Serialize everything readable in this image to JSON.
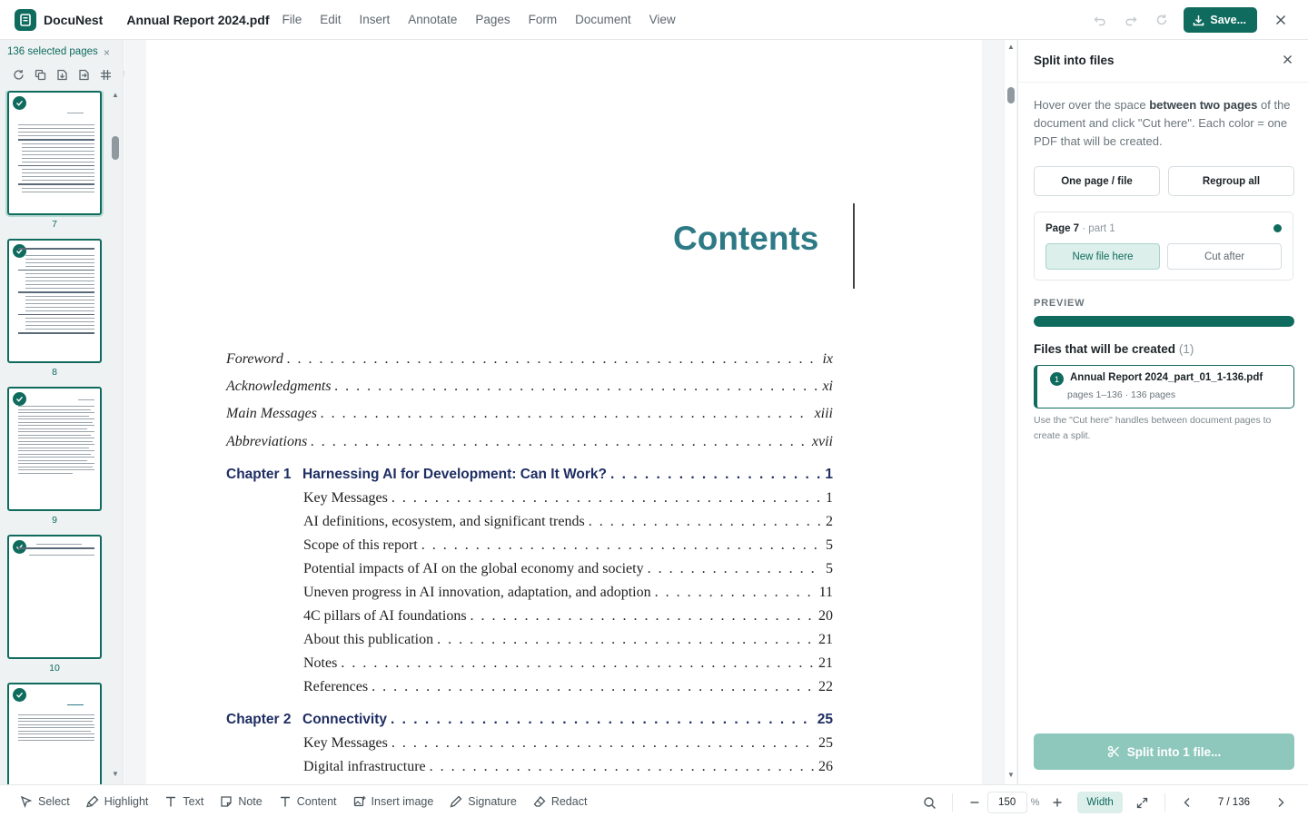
{
  "app": {
    "name": "DocuNest",
    "doc_title": "Annual Report 2024.pdf",
    "save_label": "Save...",
    "menu": [
      "File",
      "Edit",
      "Insert",
      "Annotate",
      "Pages",
      "Form",
      "Document",
      "View"
    ],
    "accent_color": "#0f6b5e"
  },
  "sidebar": {
    "selected_label": "136 selected pages",
    "close_label": "×",
    "thumbnails": [
      {
        "page": "7",
        "kind": "contents"
      },
      {
        "page": "8",
        "kind": "toc"
      },
      {
        "page": "9",
        "kind": "dense"
      },
      {
        "page": "10",
        "kind": "sparse"
      },
      {
        "page": "",
        "kind": "foreword"
      }
    ]
  },
  "document": {
    "contents_title": "Contents",
    "front_matter": [
      {
        "title": "Foreword",
        "page": "ix"
      },
      {
        "title": "Acknowledgments",
        "page": "xi"
      },
      {
        "title": "Main Messages",
        "page": "xiii"
      },
      {
        "title": "Abbreviations",
        "page": "xvii"
      }
    ],
    "chapters": [
      {
        "label": "Chapter 1",
        "title": "Harnessing AI for Development: Can It Work?",
        "page": "1",
        "sections": [
          {
            "title": "Key Messages",
            "page": "1"
          },
          {
            "title": "AI definitions, ecosystem, and significant trends",
            "page": "2"
          },
          {
            "title": "Scope of this report",
            "page": "5"
          },
          {
            "title": "Potential impacts of AI on the global economy and society",
            "page": "5"
          },
          {
            "title": "Uneven progress in AI innovation, adaptation, and adoption",
            "page": "11"
          },
          {
            "title": "4C pillars of AI foundations",
            "page": "20"
          },
          {
            "title": "About this publication",
            "page": "21"
          },
          {
            "title": "Notes",
            "page": "21"
          },
          {
            "title": "References",
            "page": "22"
          }
        ]
      },
      {
        "label": "Chapter 2",
        "title": "Connectivity",
        "page": "25",
        "sections": [
          {
            "title": "Key Messages",
            "page": "25"
          },
          {
            "title": "Digital infrastructure",
            "page": "26"
          }
        ]
      }
    ]
  },
  "panel": {
    "title": "Split into files",
    "desc_part1": "Hover over the space ",
    "desc_bold": "between two pages",
    "desc_part2": " of the document and click \"Cut here\". Each color = one PDF that will be created.",
    "one_page_label": "One page / file",
    "regroup_label": "Regroup all",
    "page_card_label": "Page 7",
    "page_card_sub": " · part 1",
    "new_file_label": "New file here",
    "cut_after_label": "Cut after",
    "preview_label": "PREVIEW",
    "preview_fill": 1.0,
    "files_title": "Files that will be created",
    "files_count": "(1)",
    "file": {
      "num": "1",
      "name": "Annual Report 2024_part_01_1-136.pdf",
      "meta": "pages 1–136 · 136 pages"
    },
    "hint": "Use the \"Cut here\" handles between document pages to create a split.",
    "split_label": "Split into 1 file..."
  },
  "bottom": {
    "tools": [
      "Select",
      "Highlight",
      "Text",
      "Note",
      "Content",
      "Insert image",
      "Signature",
      "Redact"
    ],
    "zoom": "150",
    "zoom_unit": "%",
    "width_label": "Width",
    "page_indicator": "7 / 136"
  }
}
